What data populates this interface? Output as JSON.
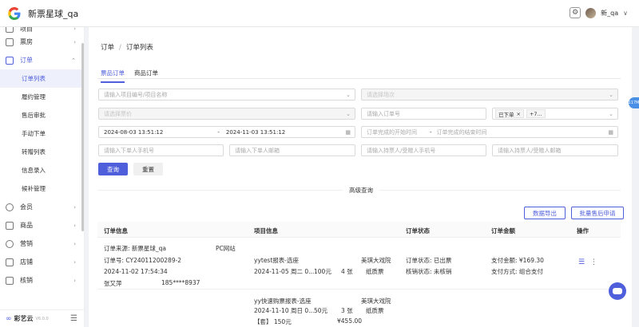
{
  "app": {
    "title": "新票星球_qa",
    "user": "新_qa"
  },
  "sidebar": {
    "partial_top": "项目",
    "items": [
      {
        "label": "票房"
      },
      {
        "label": "订单"
      }
    ],
    "subitems": [
      "订单列表",
      "履约管理",
      "售后审批",
      "手动下单",
      "转赠列表",
      "信息录入",
      "候补管理"
    ],
    "lower_items": [
      "会员",
      "商品",
      "营销",
      "店铺",
      "核销"
    ],
    "footer": {
      "brand": "彩艺云",
      "version": "V6.0.0"
    }
  },
  "breadcrumb": {
    "root": "订单",
    "sep": "/",
    "current": "订单列表"
  },
  "tabs": [
    "票品订单",
    "商品订单"
  ],
  "filters": {
    "project": "请输入项目编号/项目名称",
    "session": "请选择场次",
    "price": "请选择票价",
    "order_no": "请输入订单号",
    "status_tag": "已下单",
    "status_more": "+7...",
    "date_start": "2024-08-03 13:51:12",
    "date_sep": "-",
    "date_end": "2024-11-03 13:51:12",
    "finish_start": "订单完成的开始时间",
    "finish_sep": "-",
    "finish_end": "订单完成的结束时间",
    "buyer_phone": "请输入下单人手机号",
    "buyer_email": "请输入下单人邮箱",
    "holder_phone": "请输入持票人/受赠人手机号",
    "holder_email": "请输入持票人/受赠人邮箱"
  },
  "buttons": {
    "search": "查询",
    "reset": "重置",
    "advanced": "高级查询",
    "export": "数据导出",
    "batch": "批量售后申请"
  },
  "table": {
    "headers": [
      "订单信息",
      "项目信息",
      "订单状态",
      "订单金额",
      "操作"
    ],
    "row1": {
      "source": "订单来源: 新票星球_qa",
      "channel": "PC网站",
      "order_no": "订单号: CY24011200289-2",
      "time": "2024-11-02 17:54:34",
      "buyer": "张又萍",
      "phone": "185****8937",
      "project": "yytest报表-选座",
      "session": "2024-11-05 周二 0...",
      "price": "100元",
      "qty": "4 张",
      "venue": "美琪大戏院",
      "ticket_type": "纸质票",
      "status": "订单状态: 已出票",
      "verify": "核销状态: 未核销",
      "amount": "支付金额: ¥169.30",
      "pay": "支付方式: 组合支付"
    },
    "row2": {
      "project": "yy快速购票报表-选座",
      "session": "2024-11-10 周日 0...",
      "price": "50元",
      "qty": "3 张",
      "venue": "美琪大戏院",
      "ticket_type": "纸质票",
      "extra": "【套】 150元",
      "extra_amount": "¥455.00"
    }
  },
  "floating": {
    "side_tab": "117M"
  }
}
